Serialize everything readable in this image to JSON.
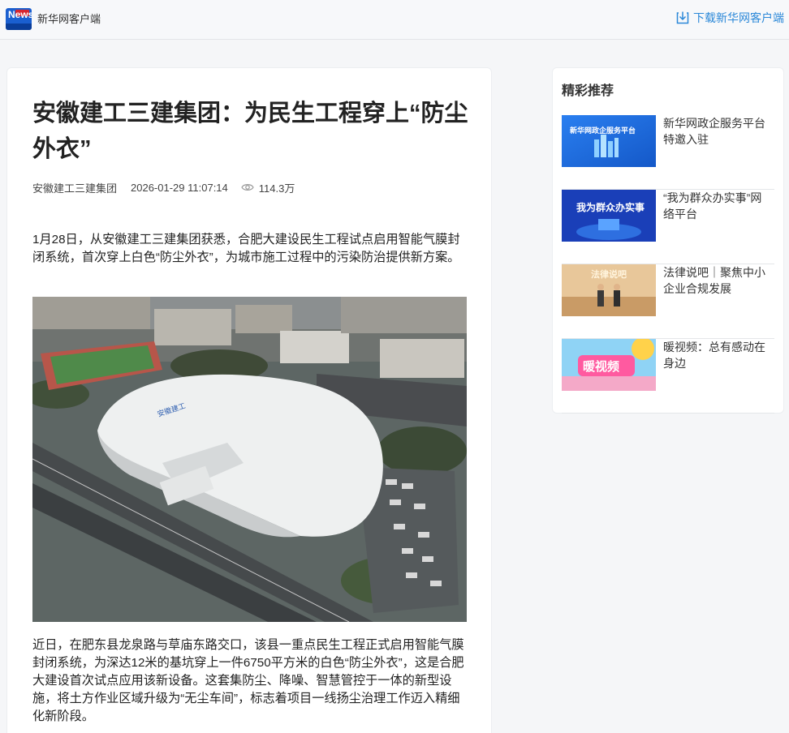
{
  "header": {
    "app_name": "新华网客户端",
    "download_label": "下载新华网客户端",
    "logo_text": "News",
    "logo_alt": "新华网"
  },
  "article": {
    "title": "安徽建工三建集团：为民生工程穿上“防尘外衣”",
    "source": "安徽建工三建集团",
    "date": "2026-01-29 11:07:14",
    "views": "114.3万",
    "paragraph1": "1月28日，从安徽建工三建集团获悉，合肥大建设民生工程试点启用智能气膜封闭系统，首次穿上白色“防尘外衣”，为城市施工过程中的污染防治提供新方案。",
    "paragraph2": "近日，在肥东县龙泉路与草庙东路交口，该县一重点民生工程正式启用智能气膜封闭系统，为深达12米的基坑穿上一件6750平方米的白色“防尘外衣”，这是合肥大建设首次试点应用该新设备。这套集防尘、降噪、智慧管控于一体的新型设施，将土方作业区域升级为“无尘车间”，标志着项目一线扬尘治理工作迈入精细化新阶段。"
  },
  "sidebar": {
    "title": "精彩推荐",
    "items": [
      {
        "caption": "新华网政企服务平台特邀入驻",
        "thumb_text": "新华网政企服务平台"
      },
      {
        "caption": "“我为群众办实事”网络平台",
        "thumb_text": "我为群众办实事"
      },
      {
        "caption": "法律说吧｜聚焦中小企业合规发展",
        "thumb_text": "法律说吧"
      },
      {
        "caption": "暖视频：总有感动在身边",
        "thumb_text": "暖视频"
      }
    ]
  },
  "colors": {
    "brand_blue": "#1a5fd0",
    "link_blue": "#2b88d8",
    "divider": "#e4e6e9"
  }
}
